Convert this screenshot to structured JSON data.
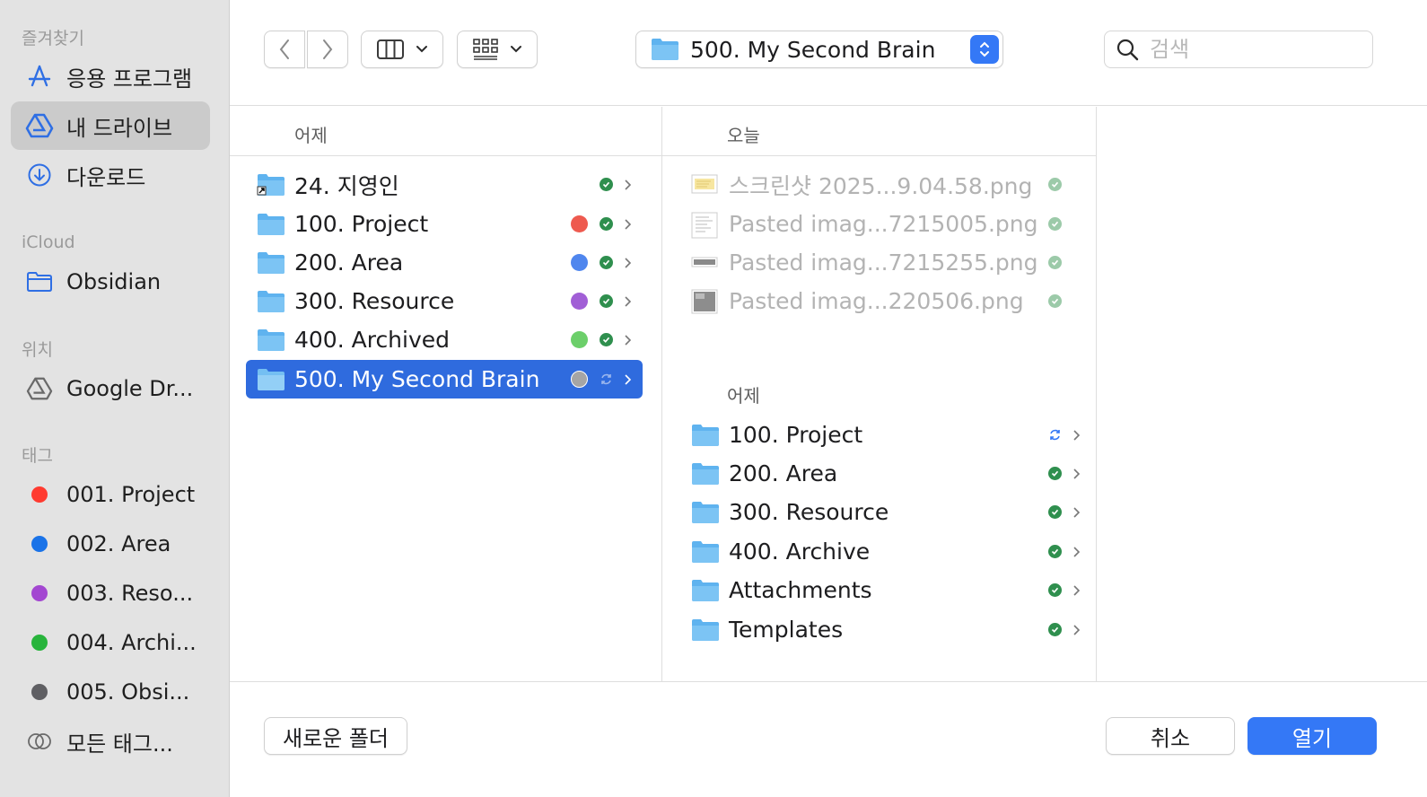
{
  "sidebar": {
    "favorites_title": "즐겨찾기",
    "favorites": [
      {
        "label": "응용 프로그램",
        "icon": "applications-icon"
      },
      {
        "label": "내 드라이브",
        "icon": "google-drive-icon",
        "selected": true
      },
      {
        "label": "다운로드",
        "icon": "download-icon"
      }
    ],
    "icloud_title": "iCloud",
    "icloud": [
      {
        "label": "Obsidian",
        "icon": "folder-icon"
      }
    ],
    "locations_title": "위치",
    "locations": [
      {
        "label": "Google Dr...",
        "icon": "google-drive-icon"
      }
    ],
    "tags_title": "태그",
    "tags": [
      {
        "label": "001. Project",
        "color": "#ff3b30"
      },
      {
        "label": "002. Area",
        "color": "#1a73e8"
      },
      {
        "label": "003. Reso...",
        "color": "#a347d1"
      },
      {
        "label": "004. Archi...",
        "color": "#28b43c"
      },
      {
        "label": "005. Obsi...",
        "color": "#5f5f63"
      },
      {
        "label": "모든 태그...",
        "icon": "all-tags-icon"
      }
    ]
  },
  "toolbar": {
    "back_icon": "chevron-left-icon",
    "forward_icon": "chevron-right-icon",
    "view_icon": "columns-view-icon",
    "group_icon": "group-grid-icon",
    "location": "500. My Second Brain",
    "search_placeholder": "검색"
  },
  "column1": {
    "header": "어제",
    "items": [
      {
        "name": "24. 지영인",
        "alias": true,
        "status": "synced"
      },
      {
        "name": "100. Project",
        "tag_color": "#ee5a4f",
        "status": "synced"
      },
      {
        "name": "200. Area",
        "tag_color": "#4f86ee",
        "status": "synced"
      },
      {
        "name": "300. Resource",
        "tag_color": "#a15fd6",
        "status": "synced"
      },
      {
        "name": "400. Archived",
        "tag_color": "#6ccf6a",
        "status": "synced"
      },
      {
        "name": "500. My Second Brain",
        "tag_color": "#9a9a9a",
        "status": "syncing",
        "selected": true
      }
    ]
  },
  "column2": {
    "header": "오늘",
    "files": [
      {
        "name": "스크린샷 2025...9.04.58.png"
      },
      {
        "name": "Pasted imag...7215005.png"
      },
      {
        "name": "Pasted imag...7215255.png"
      },
      {
        "name": "Pasted imag...220506.png"
      }
    ],
    "subheader": "어제",
    "folders": [
      {
        "name": "100. Project",
        "status": "syncing"
      },
      {
        "name": "200. Area",
        "status": "synced"
      },
      {
        "name": "300. Resource",
        "status": "synced"
      },
      {
        "name": "400. Archive",
        "status": "synced"
      },
      {
        "name": "Attachments",
        "status": "synced"
      },
      {
        "name": "Templates",
        "status": "synced"
      }
    ]
  },
  "buttons": {
    "new_folder": "새로운 폴더",
    "cancel": "취소",
    "open": "열기"
  },
  "colors": {
    "accent": "#3478f6",
    "selection": "#2f6bde",
    "sync_green": "#2f8f4e"
  }
}
